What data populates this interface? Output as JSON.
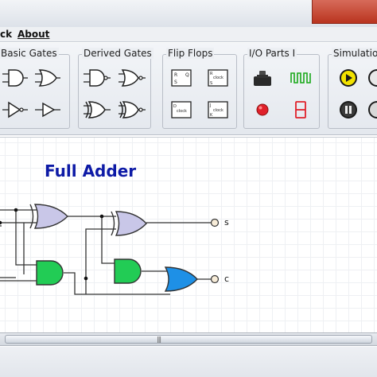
{
  "menu": {
    "partial_label": "ck",
    "about_label": "About"
  },
  "toolbar": {
    "groups": {
      "basic": "Basic Gates",
      "derived": "Derived Gates",
      "flipflops": "Flip Flops",
      "io": "I/O Parts I",
      "simulation": "Simulation"
    },
    "flipflop_text": {
      "clock": "clock",
      "r": "R",
      "s": "S",
      "q": "Q",
      "d": "D",
      "j": "J",
      "k": "K"
    }
  },
  "canvas": {
    "title": "Full Adder",
    "outputs": {
      "s_label": "s",
      "c_label": "c"
    }
  },
  "scrollbar": {
    "grip": "|||"
  },
  "colors": {
    "xor_gate": "#c9c7e8",
    "and_gate": "#22cc55",
    "or_gate": "#1e90e6",
    "title_text": "#0d1aa6",
    "play_button": "#f2e200",
    "led_red": "#e0202a"
  }
}
